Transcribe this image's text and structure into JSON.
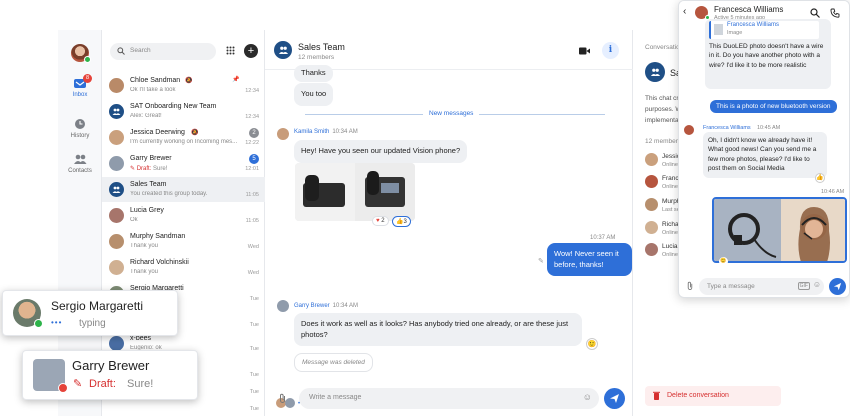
{
  "nav": {
    "inbox": {
      "label": "Inbox",
      "badge": "8"
    },
    "history": {
      "label": "History"
    },
    "contacts": {
      "label": "Contacts"
    }
  },
  "search": {
    "placeholder": "Search"
  },
  "conversations": [
    {
      "name": "Chloe Sandman",
      "preview": "Ok I'll take a look",
      "time": "12:34",
      "count": "",
      "muted": true,
      "pinned": true
    },
    {
      "name": "SAT Onboarding New Team",
      "preview": "Alex: Great!",
      "time": "12:34",
      "count": ""
    },
    {
      "name": "Jessica Deerwing",
      "preview": "I'm currently working on Incoming mes...",
      "time": "12:22",
      "count": "2"
    },
    {
      "name": "Garry Brewer",
      "draft_label": "Draft:",
      "preview": "Sure!",
      "time": "12:01",
      "count": "5"
    },
    {
      "name": "Sales Team",
      "preview": "You created this group today.",
      "time": "11:05",
      "count": ""
    },
    {
      "name": "Lucia Grey",
      "preview": "Ok",
      "time": "11:05",
      "count": ""
    },
    {
      "name": "Murphy Sandman",
      "preview": "Thank you",
      "time": "Wed",
      "count": ""
    },
    {
      "name": "Richard Volchinskii",
      "preview": "Thank you",
      "time": "Wed",
      "count": ""
    },
    {
      "name": "Sergio Margaretti",
      "preview": "",
      "time": "Tue",
      "count": ""
    },
    {
      "name": "",
      "preview": "",
      "time": "Tue",
      "count": ""
    },
    {
      "name": "x-bees",
      "preview": "Eugenio: ok",
      "time": "Tue",
      "count": ""
    },
    {
      "name": "",
      "preview": "",
      "time": "Tue",
      "count": ""
    },
    {
      "name": "",
      "preview": "",
      "time": "Tue",
      "count": ""
    },
    {
      "name": "",
      "preview": "",
      "time": "Tue",
      "count": ""
    }
  ],
  "chat": {
    "title": "Sales Team",
    "subtitle": "12 members",
    "msg_thanks": "Thanks",
    "msg_you_too": "You too",
    "new_messages": "New messages",
    "kamila_name": "Kamila Smith",
    "kamila_time": "10:34 AM",
    "kamila_msg": "Hey! Have you seen our updated Vision phone?",
    "reaction1": "2",
    "reaction2": "3",
    "out_time": "10:37 AM",
    "out_msg": "Wow! Never seen it before, thanks!",
    "garry_name": "Garry Brewer",
    "garry_time": "10:34 AM",
    "garry_msg": "Does it work as well as it looks? Has anybody tried one already, or are these just photos?",
    "deleted": "Message was deleted",
    "composer_placeholder": "Write a message"
  },
  "right": {
    "header": "Conversation",
    "title": "Sa",
    "desc1": "This chat cr",
    "desc2": "purposes. W",
    "desc3": "implementat",
    "members_label": "12 members",
    "members": [
      {
        "name": "Jessic",
        "status": "Online"
      },
      {
        "name": "France",
        "status": "Online"
      },
      {
        "name": "Murph",
        "status": "Last see"
      },
      {
        "name": "Richar",
        "status": "Online"
      },
      {
        "name": "Lucia",
        "status": "Online"
      }
    ],
    "delete": "Delete conversation"
  },
  "popup": {
    "name": "Francesca Williams",
    "status": "Active 5 minutes ago",
    "quote_name": "Francesca Williams",
    "quote_type": "Image",
    "msg1": "This DuoLED photo doesn't have a wire in it. Do you have another photo with a wire? I'd like it to be more realistic",
    "out_msg": "This is a photo of new bluetooth version",
    "sender": "Francesca Williams",
    "sender_time": "10:45 AM",
    "msg2": "Oh, I didn't know we already have it! What good news! Can you send me a few more photos, please? I'd like to post them on Social Media",
    "img_time": "10:46 AM",
    "placeholder": "Type a message",
    "gif": "GIF"
  },
  "typing_card": {
    "name": "Sergio Margaretti",
    "status": "typing"
  },
  "draft_card": {
    "name": "Garry Brewer",
    "draft_label": "Draft:",
    "text": "Sure!"
  }
}
